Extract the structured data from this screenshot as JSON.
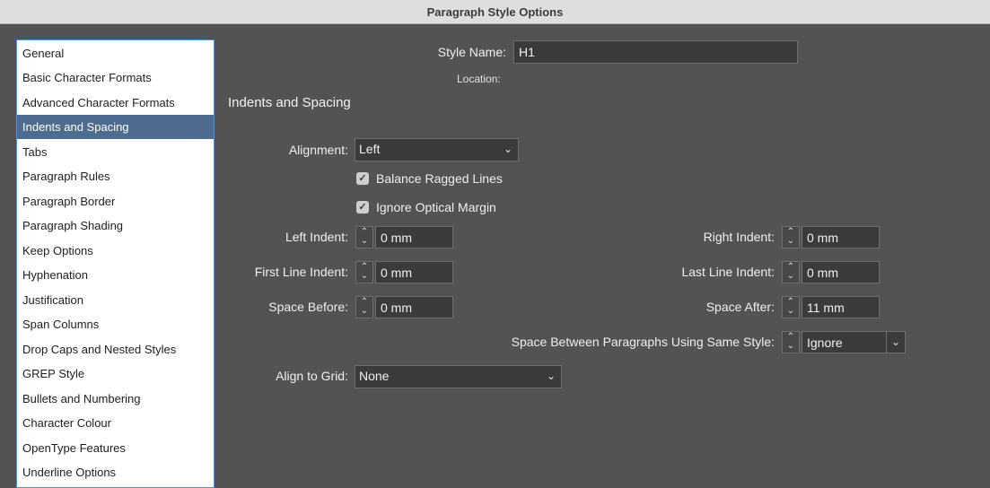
{
  "window": {
    "title": "Paragraph Style Options"
  },
  "sidebar": {
    "items": [
      {
        "label": "General"
      },
      {
        "label": "Basic Character Formats"
      },
      {
        "label": "Advanced Character Formats"
      },
      {
        "label": "Indents and Spacing",
        "selected": true
      },
      {
        "label": "Tabs"
      },
      {
        "label": "Paragraph Rules"
      },
      {
        "label": "Paragraph Border"
      },
      {
        "label": "Paragraph Shading"
      },
      {
        "label": "Keep Options"
      },
      {
        "label": "Hyphenation"
      },
      {
        "label": "Justification"
      },
      {
        "label": "Span Columns"
      },
      {
        "label": "Drop Caps and Nested Styles"
      },
      {
        "label": "GREP Style"
      },
      {
        "label": "Bullets and Numbering"
      },
      {
        "label": "Character Colour"
      },
      {
        "label": "OpenType Features"
      },
      {
        "label": "Underline Options"
      }
    ]
  },
  "header": {
    "style_name_label": "Style Name:",
    "style_name_value": "H1",
    "location_label": "Location:"
  },
  "section": {
    "title": "Indents and Spacing"
  },
  "form": {
    "alignment_label": "Alignment:",
    "alignment_value": "Left",
    "balance_ragged_lines_label": "Balance Ragged Lines",
    "balance_ragged_lines_checked": true,
    "ignore_optical_margin_label": "Ignore Optical Margin",
    "ignore_optical_margin_checked": true,
    "left_indent_label": "Left Indent:",
    "left_indent_value": "0 mm",
    "right_indent_label": "Right Indent:",
    "right_indent_value": "0 mm",
    "first_line_indent_label": "First Line Indent:",
    "first_line_indent_value": "0 mm",
    "last_line_indent_label": "Last Line Indent:",
    "last_line_indent_value": "0 mm",
    "space_before_label": "Space Before:",
    "space_before_value": "0 mm",
    "space_after_label": "Space After:",
    "space_after_value": "11 mm",
    "space_between_label": "Space Between Paragraphs Using Same Style:",
    "space_between_value": "Ignore",
    "align_to_grid_label": "Align to Grid:",
    "align_to_grid_value": "None"
  },
  "icons": {
    "chevron": "chevron-down-icon",
    "check": "checkmark-icon",
    "stepper": "stepper-icon"
  },
  "colors": {
    "panel_bg": "#535353",
    "selection": "#4e6c8f",
    "sidebar_border": "#5f8fc7"
  }
}
